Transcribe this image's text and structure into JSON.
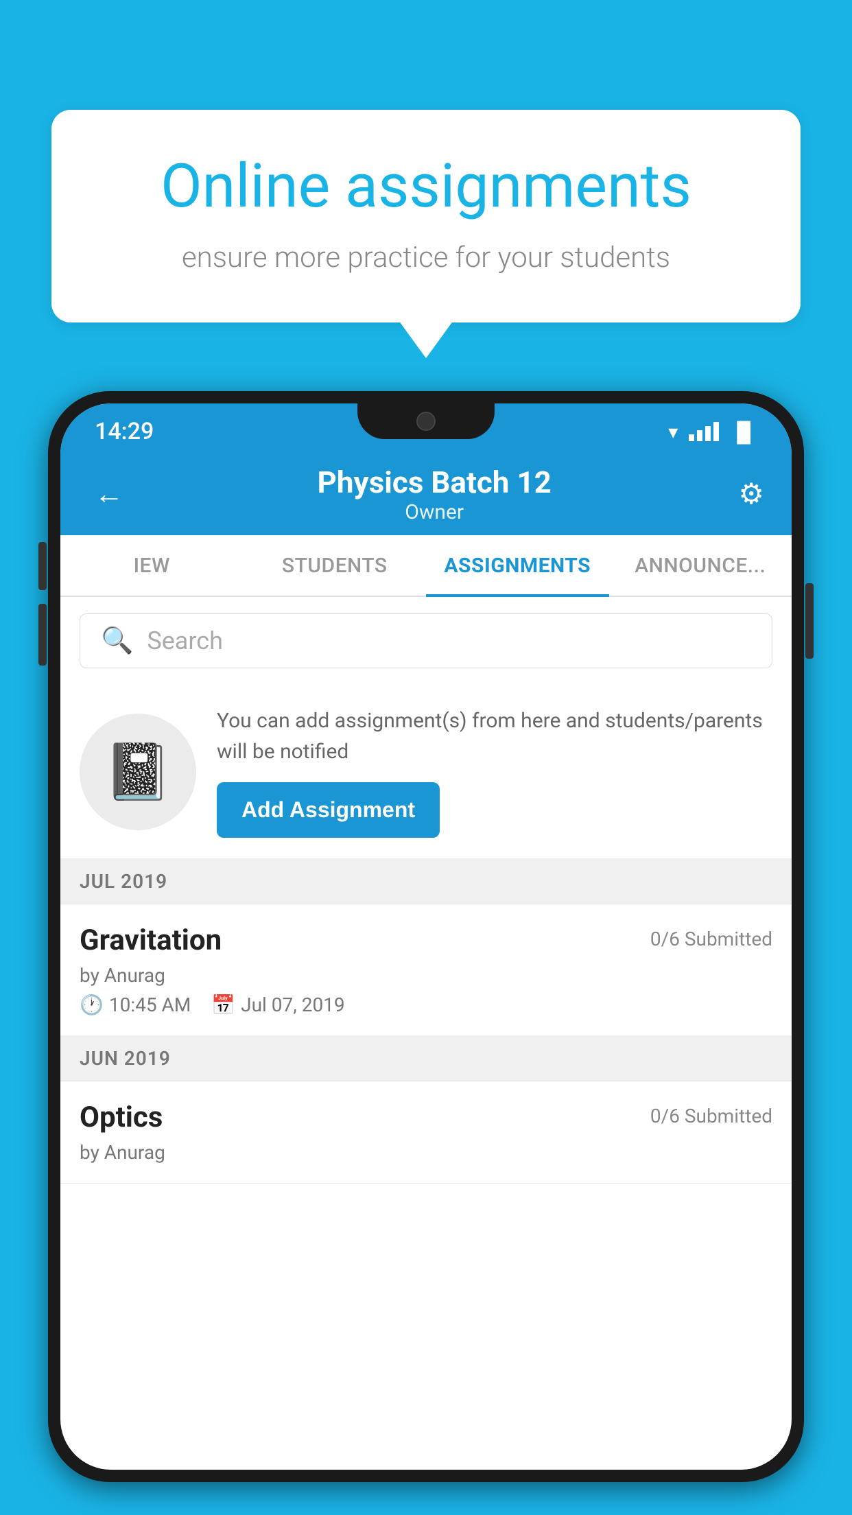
{
  "background_color": "#1ab3e6",
  "speech_bubble": {
    "title": "Online assignments",
    "subtitle": "ensure more practice for your students"
  },
  "phone": {
    "status_bar": {
      "time": "14:29",
      "signal": "▲▲",
      "battery": "▮"
    },
    "header": {
      "back_label": "←",
      "title": "Physics Batch 12",
      "subtitle": "Owner",
      "settings_label": "⚙"
    },
    "tabs": [
      {
        "label": "IEW",
        "active": false
      },
      {
        "label": "STUDENTS",
        "active": false
      },
      {
        "label": "ASSIGNMENTS",
        "active": true
      },
      {
        "label": "ANNOUNCE...",
        "active": false
      }
    ],
    "search": {
      "placeholder": "Search"
    },
    "info_card": {
      "description": "You can add assignment(s) from here and students/parents will be notified",
      "button_label": "Add Assignment"
    },
    "assignments": [
      {
        "month_label": "JUL 2019",
        "items": [
          {
            "name": "Gravitation",
            "submitted": "0/6 Submitted",
            "by": "by Anurag",
            "time": "10:45 AM",
            "date": "Jul 07, 2019"
          }
        ]
      },
      {
        "month_label": "JUN 2019",
        "items": [
          {
            "name": "Optics",
            "submitted": "0/6 Submitted",
            "by": "by Anurag",
            "time": "",
            "date": ""
          }
        ]
      }
    ]
  }
}
